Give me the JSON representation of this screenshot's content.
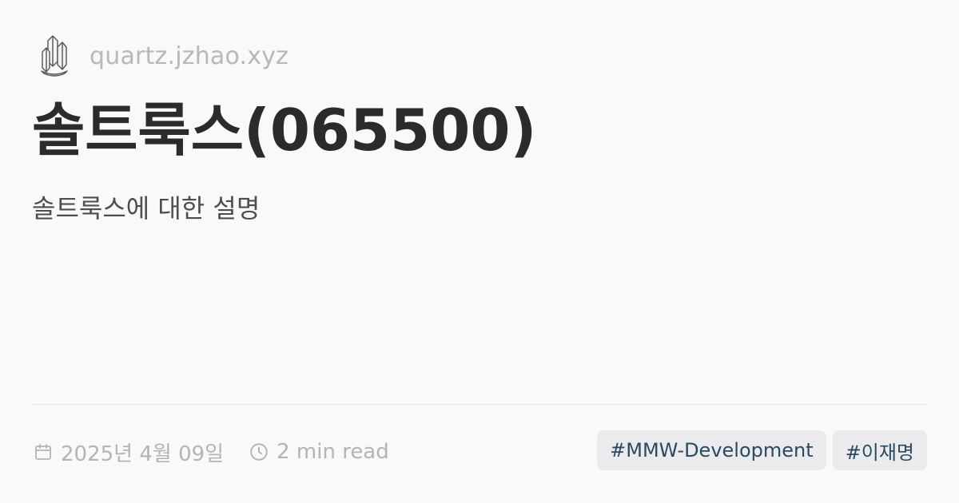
{
  "site": {
    "icon": "quartz-crystal-icon",
    "url": "quartz.jzhao.xyz"
  },
  "page": {
    "title": "솔트룩스(065500)",
    "description": "솔트룩스에 대한 설명"
  },
  "meta": {
    "date": "2025년 4월 09일",
    "date_icon": "calendar-icon",
    "reading_time": "2 min read",
    "time_icon": "clock-icon"
  },
  "tags": [
    {
      "label": "#MMW-Development"
    },
    {
      "label": "#이재명"
    }
  ],
  "colors": {
    "background": "#faf8f8",
    "title": "#2b2b2b",
    "muted": "#b4b4b4",
    "tag_background": "#ebebed",
    "tag_text": "#284b63"
  }
}
